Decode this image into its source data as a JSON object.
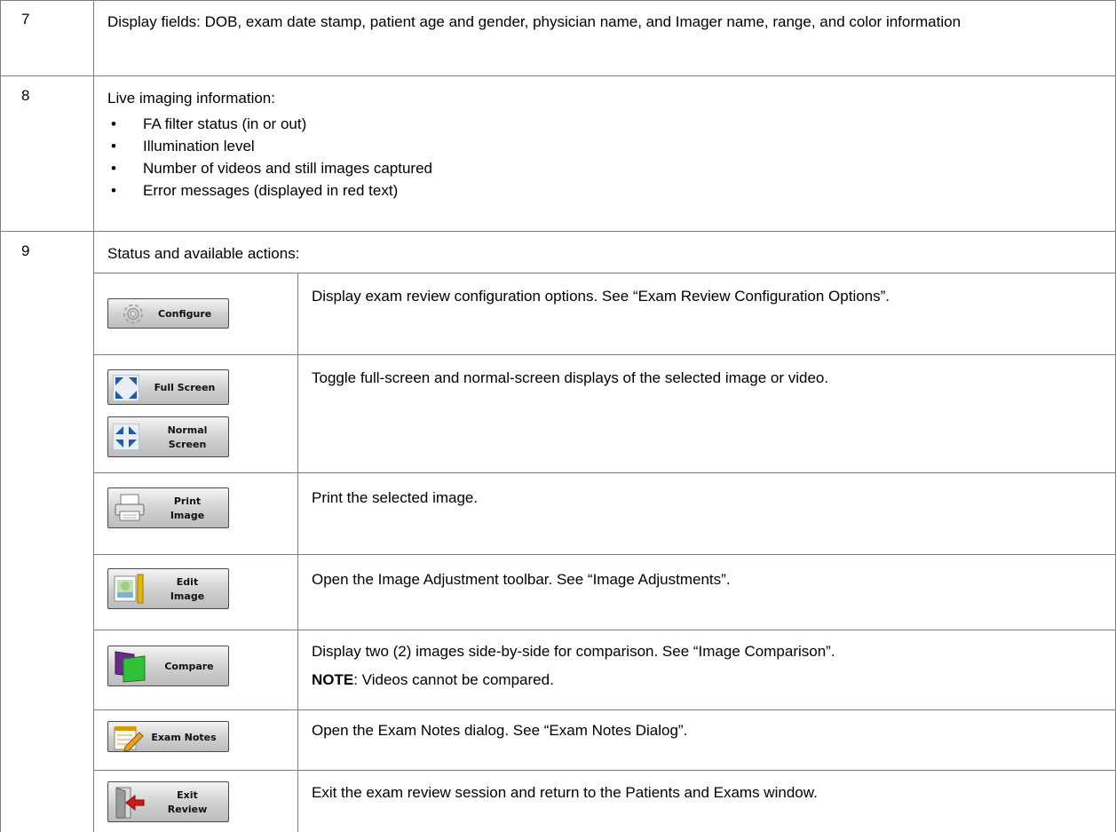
{
  "rows": {
    "r7": {
      "number": "7",
      "text": "Display fields: DOB, exam date stamp, patient age and gender, physician name, and Imager name, range, and color information"
    },
    "r8": {
      "number": "8",
      "intro": "Live imaging information:",
      "bullets": [
        "FA filter status (in or out)",
        "Illumination level",
        "Number of videos and still images captured",
        "Error messages (displayed in red text)"
      ]
    },
    "r9": {
      "number": "9",
      "intro": "Status and available actions:",
      "actions": {
        "configure": {
          "button": "Configure",
          "description": "Display exam review configuration options. See “Exam Review Configuration Options”."
        },
        "fullscreen": {
          "button": "Full Screen",
          "button2_line1": "Normal",
          "button2_line2": "Screen",
          "description": "Toggle full-screen and normal-screen displays of the selected image or video."
        },
        "print": {
          "button_line1": "Print",
          "button_line2": "Image",
          "description": "Print the selected image."
        },
        "edit": {
          "button_line1": "Edit",
          "button_line2": "Image",
          "description": "Open the Image Adjustment toolbar. See “Image Adjustments”."
        },
        "compare": {
          "button": "Compare",
          "description": "Display two (2) images side-by-side for comparison. See “Image Comparison”.",
          "note_label": "NOTE",
          "note_text": ": Videos cannot be compared."
        },
        "notes": {
          "button": "Exam Notes",
          "description": "Open the Exam Notes dialog. See “Exam Notes Dialog”."
        },
        "exit": {
          "button_line1": "Exit",
          "button_line2": "Review",
          "description": "Exit the exam review session and return to the Patients and Exams window."
        }
      }
    }
  }
}
